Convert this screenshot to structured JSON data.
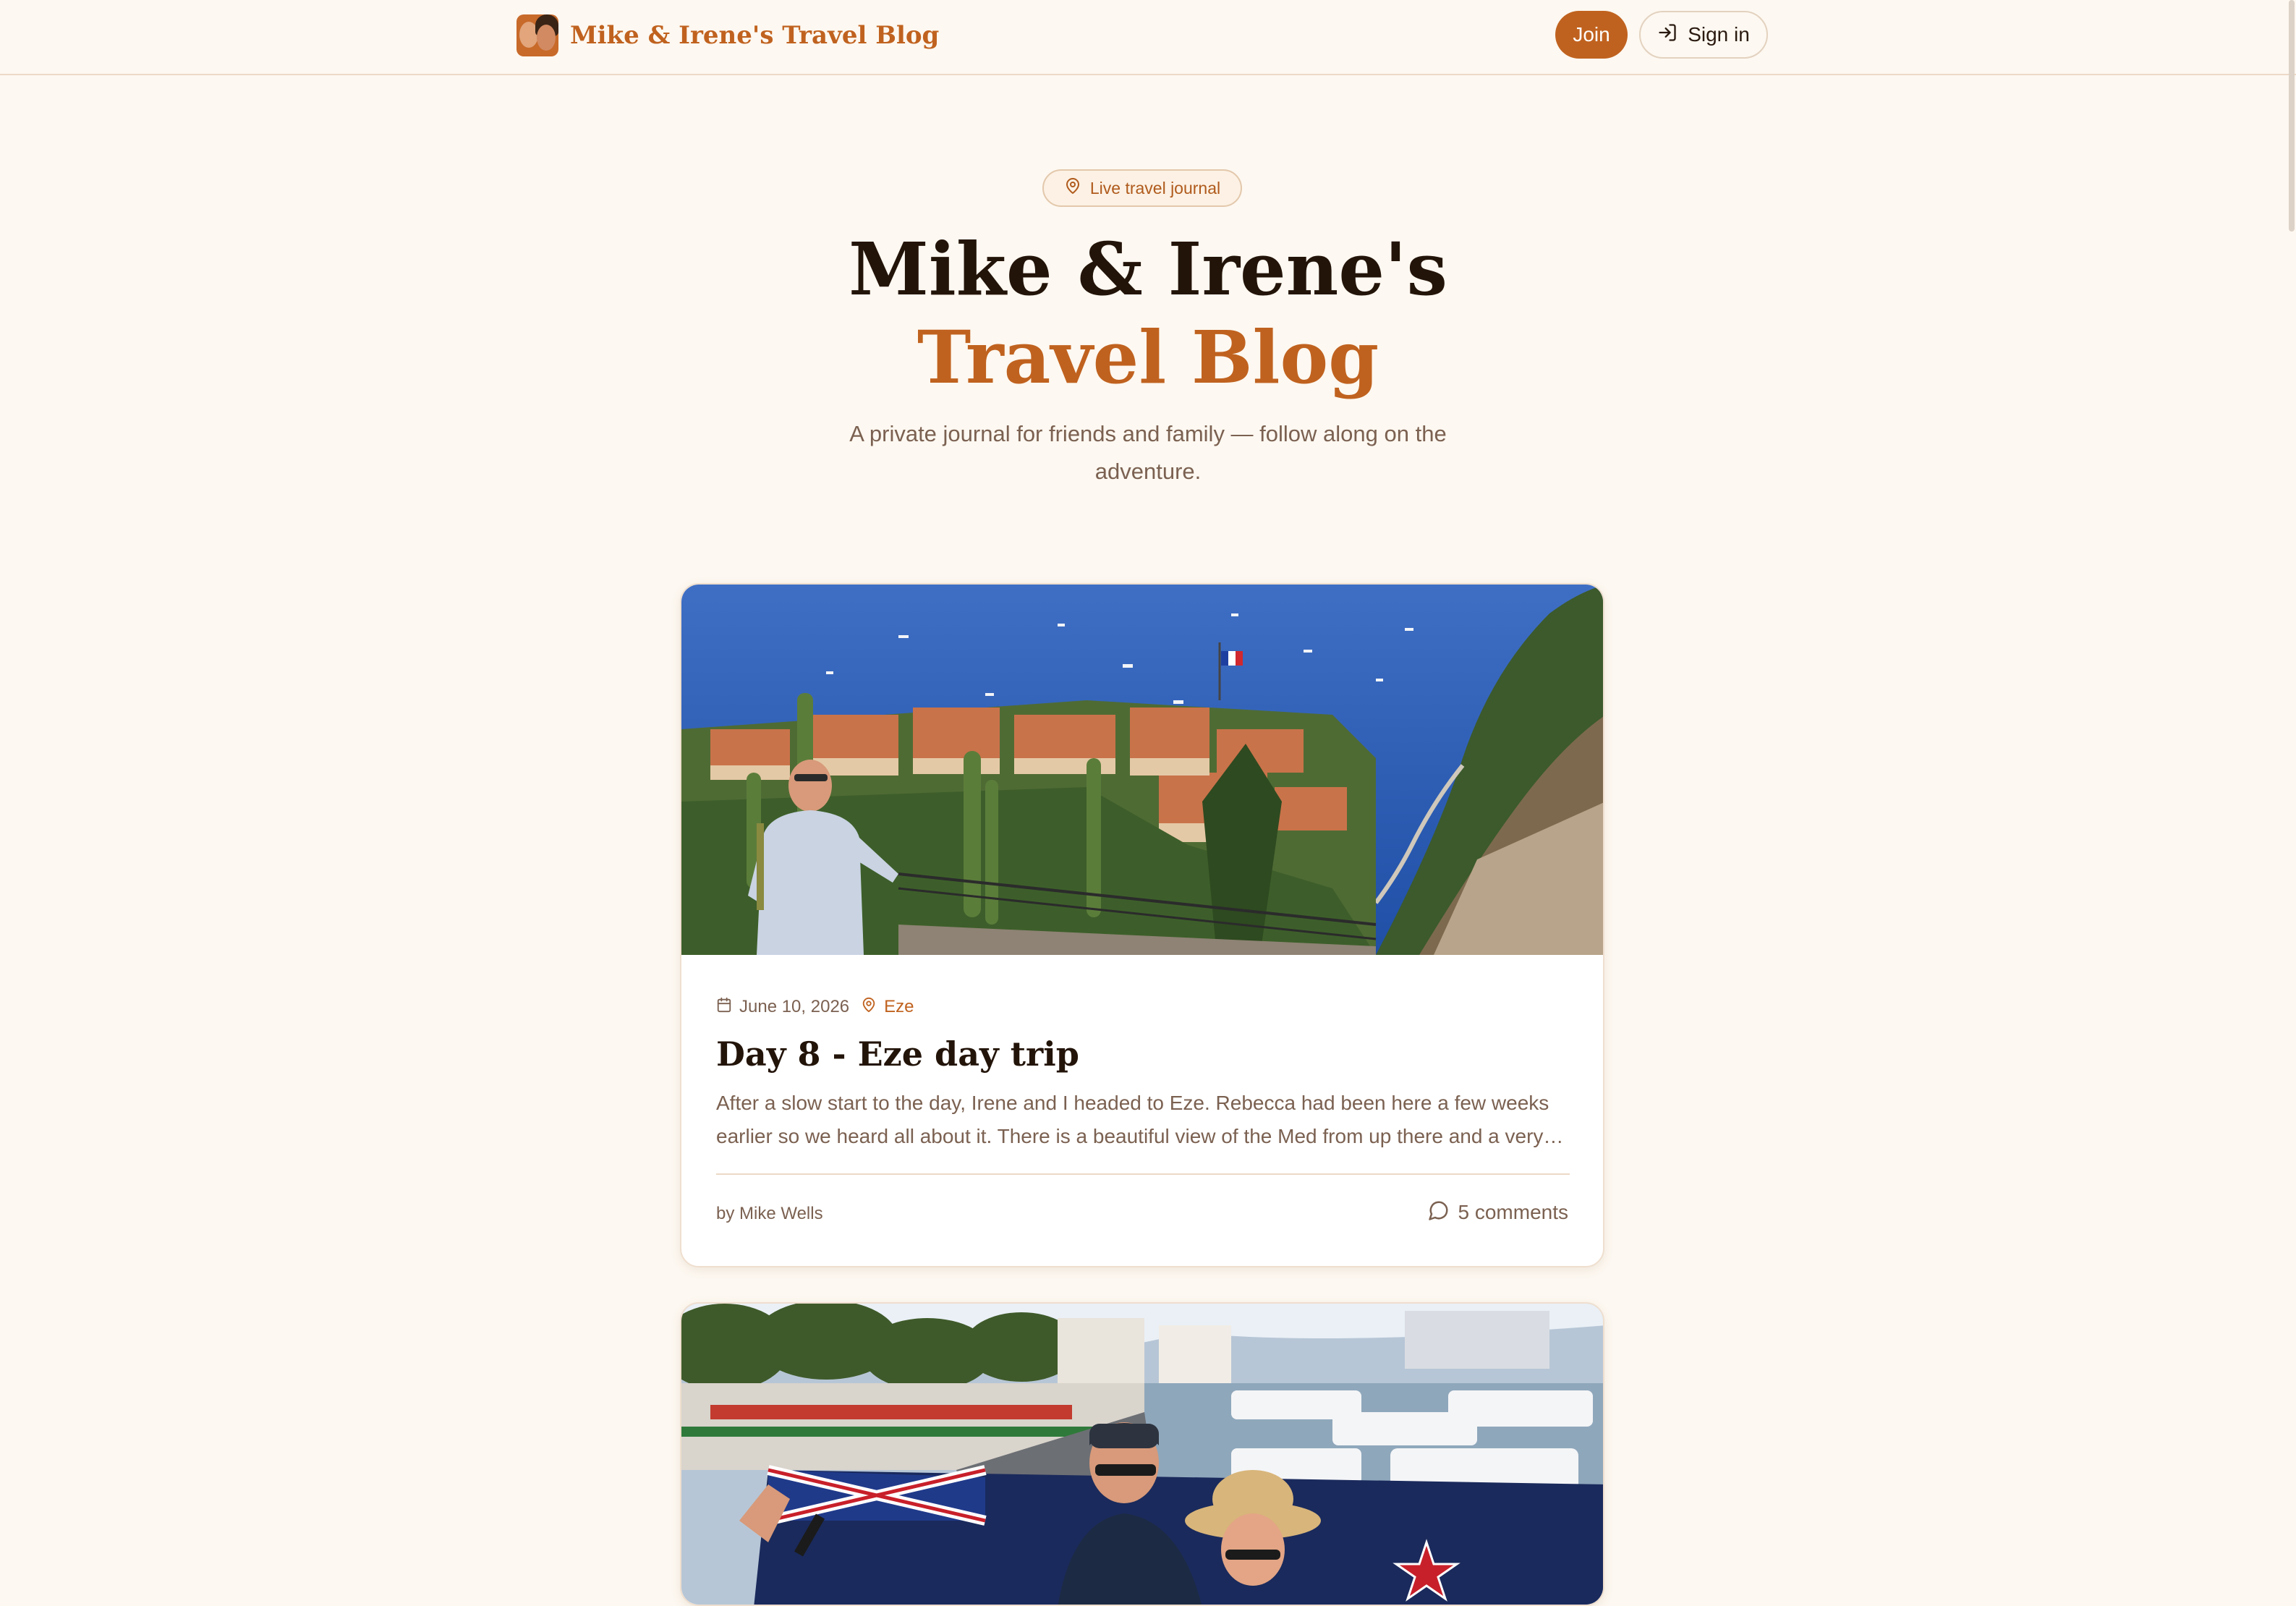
{
  "header": {
    "brand_title": "Mike & Irene's Travel Blog",
    "join_label": "Join",
    "signin_label": "Sign in"
  },
  "hero": {
    "badge": "Live travel journal",
    "title_line1": "Mike & Irene's",
    "title_line2": "Travel Blog",
    "subtitle": "A private journal for friends and family — follow along on the adventure."
  },
  "posts": [
    {
      "date": "June 10, 2026",
      "location": "Eze",
      "title": "Day 8 - Eze day trip",
      "excerpt": "After a slow start to the day, Irene and I headed to Eze. Rebecca had been here a few weeks earlier so we heard all about it. There is a beautiful view of the Med from up there and a very…",
      "author": "by Mike Wells",
      "comments": "5 comments"
    }
  ],
  "colors": {
    "accent": "#c0621f",
    "background": "#fdf8f1",
    "heading": "#231409",
    "muted": "#7b6151"
  },
  "icons": {
    "badge": "map-pin-icon",
    "signin": "login-icon",
    "date": "calendar-icon",
    "location": "map-pin-icon",
    "comments": "comment-bubble-icon"
  }
}
